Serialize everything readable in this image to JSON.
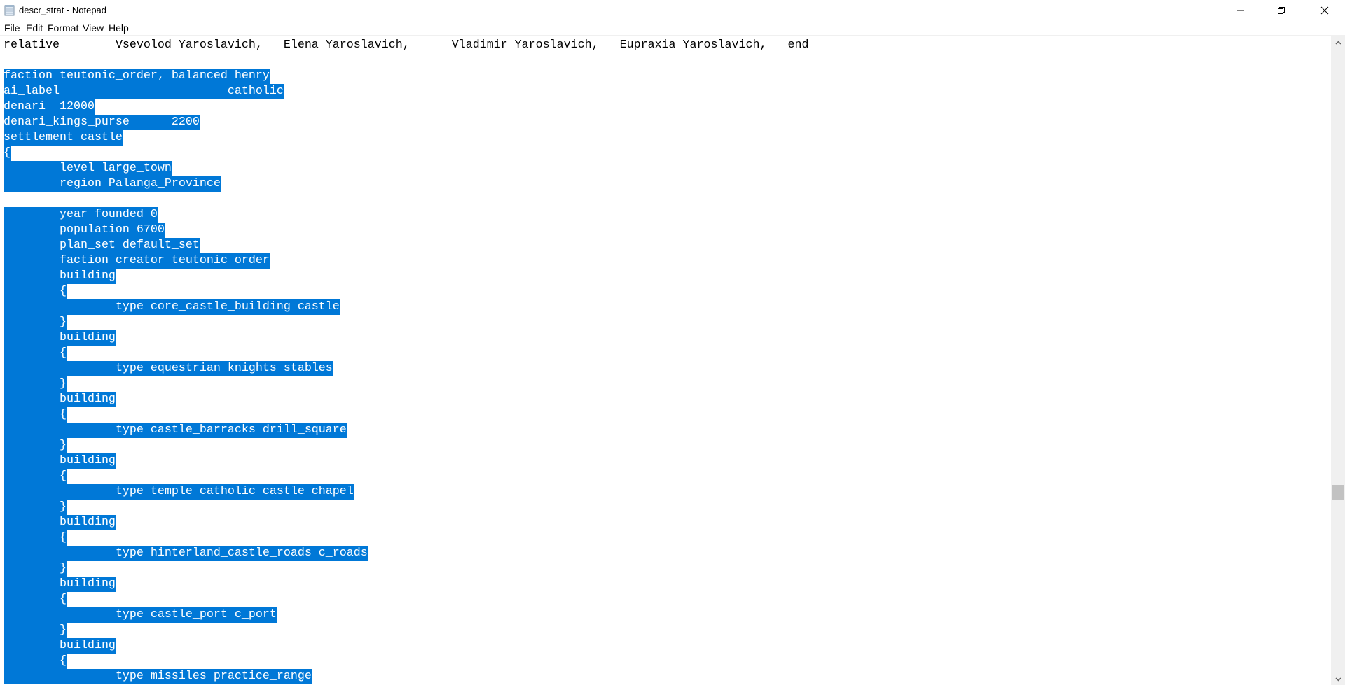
{
  "window": {
    "title": "descr_strat - Notepad",
    "icon": "notepad-icon",
    "controls": [
      "minimize-icon",
      "restore-icon",
      "close-icon"
    ]
  },
  "menu": [
    "File",
    "Edit",
    "Format",
    "View",
    "Help"
  ],
  "editor": {
    "selection_color": "#0078d7",
    "lines": [
      {
        "text": "relative\tVsevolod Yaroslavich,\tElena Yaroslavich,\tVladimir Yaroslavich,\tEupraxia Yaroslavich,\tend",
        "selected": false
      },
      {
        "text": "",
        "selected": false
      },
      {
        "text": "faction teutonic_order, balanced henry",
        "selected": true
      },
      {
        "text": "ai_label\t\t\tcatholic",
        "selected": true
      },
      {
        "text": "denari\t12000",
        "selected": true
      },
      {
        "text": "denari_kings_purse\t2200",
        "selected": true
      },
      {
        "text": "settlement castle",
        "selected": true
      },
      {
        "text": "{",
        "selected": true
      },
      {
        "text": "\tlevel large_town",
        "selected": true
      },
      {
        "text": "\tregion Palanga_Province",
        "selected": true
      },
      {
        "text": "",
        "selected": false
      },
      {
        "text": "\tyear_founded 0",
        "selected": true
      },
      {
        "text": "\tpopulation 6700",
        "selected": true
      },
      {
        "text": "\tplan_set default_set",
        "selected": true
      },
      {
        "text": "\tfaction_creator teutonic_order",
        "selected": true
      },
      {
        "text": "\tbuilding",
        "selected": true
      },
      {
        "text": "\t{",
        "selected": true
      },
      {
        "text": "\t\ttype core_castle_building castle",
        "selected": true
      },
      {
        "text": "\t}",
        "selected": true
      },
      {
        "text": "\tbuilding",
        "selected": true
      },
      {
        "text": "\t{",
        "selected": true
      },
      {
        "text": "\t\ttype equestrian knights_stables",
        "selected": true
      },
      {
        "text": "\t}",
        "selected": true
      },
      {
        "text": "\tbuilding",
        "selected": true
      },
      {
        "text": "\t{",
        "selected": true
      },
      {
        "text": "\t\ttype castle_barracks drill_square",
        "selected": true
      },
      {
        "text": "\t}",
        "selected": true
      },
      {
        "text": "\tbuilding",
        "selected": true
      },
      {
        "text": "\t{",
        "selected": true
      },
      {
        "text": "\t\ttype temple_catholic_castle chapel",
        "selected": true
      },
      {
        "text": "\t}",
        "selected": true
      },
      {
        "text": "\tbuilding",
        "selected": true
      },
      {
        "text": "\t{",
        "selected": true
      },
      {
        "text": "\t\ttype hinterland_castle_roads c_roads",
        "selected": true
      },
      {
        "text": "\t}",
        "selected": true
      },
      {
        "text": "\tbuilding",
        "selected": true
      },
      {
        "text": "\t{",
        "selected": true
      },
      {
        "text": "\t\ttype castle_port c_port",
        "selected": true
      },
      {
        "text": "\t}",
        "selected": true
      },
      {
        "text": "\tbuilding",
        "selected": true
      },
      {
        "text": "\t{",
        "selected": true
      },
      {
        "text": "\t\ttype missiles practice_range",
        "selected": true
      }
    ]
  },
  "scrollbar": {
    "position_fraction": 0.7
  }
}
